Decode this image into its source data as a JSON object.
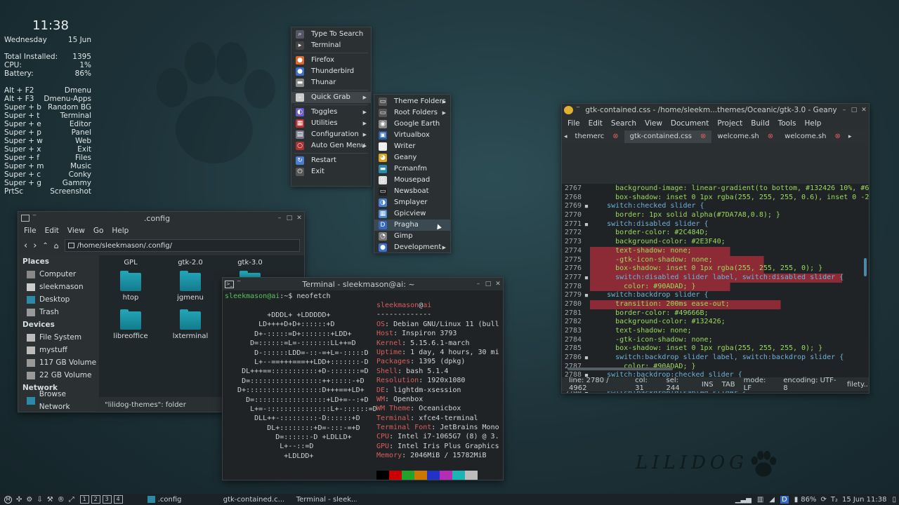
{
  "conky": {
    "time": "11:38",
    "day": "Wednesday",
    "date": "15 Jun",
    "stats": [
      {
        "k": "Total Installed:",
        "v": "1395"
      },
      {
        "k": "CPU:",
        "v": "1%"
      },
      {
        "k": "Battery:",
        "v": "86%"
      }
    ],
    "keys": [
      {
        "k": "Alt + F2",
        "v": "Dmenu"
      },
      {
        "k": "Alt + F3",
        "v": "Dmenu-Apps"
      },
      {
        "k": "Super + b",
        "v": "Random BG"
      },
      {
        "k": "Super + t",
        "v": "Terminal"
      },
      {
        "k": "Super + e",
        "v": "Editor"
      },
      {
        "k": "Super + p",
        "v": "Panel"
      },
      {
        "k": "Super + w",
        "v": "Web"
      },
      {
        "k": "Super + x",
        "v": "Exit"
      },
      {
        "k": "Super + f",
        "v": "Files"
      },
      {
        "k": "Super + m",
        "v": "Music"
      },
      {
        "k": "Super + c",
        "v": "Conky"
      },
      {
        "k": "Super + g",
        "v": "Gammy"
      },
      {
        "k": "PrtSc",
        "v": "Screenshot"
      }
    ]
  },
  "root_menu": {
    "items": [
      "Type To Search",
      "Terminal",
      "Firefox",
      "Thunderbird",
      "Thunar",
      "Quick Grab",
      "Toggles",
      "Utilities",
      "Configuration",
      "Auto Gen Menu",
      "Restart",
      "Exit"
    ]
  },
  "submenu": {
    "items": [
      "Theme Folders",
      "Root Folders",
      "Google Earth",
      "Virtualbox",
      "Writer",
      "Geany",
      "Pcmanfm",
      "Mousepad",
      "Newsboat",
      "Smplayer",
      "Gpicview",
      "Pragha",
      "Gimp",
      "Development"
    ]
  },
  "filemanager": {
    "title": ".config",
    "menu": [
      "File",
      "Edit",
      "View",
      "Go",
      "Help"
    ],
    "path": "/home/sleekmason/.config/",
    "places_header": "Places",
    "places": [
      "Computer",
      "sleekmason",
      "Desktop",
      "Trash"
    ],
    "devices_header": "Devices",
    "devices": [
      "File System",
      "mystuff",
      "117 GB Volume",
      "22 GB Volume"
    ],
    "network_header": "Network",
    "network": [
      "Browse Network"
    ],
    "files": [
      "GPL",
      "gtk-2.0",
      "gtk-3.0",
      "htop",
      "jgmenu",
      "libfm",
      "libreoffice",
      "lxterminal",
      "Mousepad"
    ],
    "ghost": [
      "lilidog-themes",
      "lilidog"
    ],
    "status": "\"lilidog-themes\": folder"
  },
  "terminal": {
    "title": "Terminal - sleekmason@ai: ~",
    "prompt": "sleekmason@ai",
    "cmd": ":~$ neofetch",
    "art": [
      "          +DDDL+ +LDDDDD+",
      "        LD++++D+D+::::::+D",
      "       D+-:::::=D+:::::::+LDD+",
      "      D=::::::=L=-:::::::LL++=D",
      "       D-::::::LDD=-::-=+L=-:::::D",
      "       L+--==+++===++LDD+:::::::-D",
      "    DL+++==:::::::::::+D-:::::::=D",
      "    D=:::::::::::::::::++:::::-+D",
      "   D+::::::::::::::::::D+++==+LD+",
      "     D=:::::::::::::::::+LD+=--:+D",
      "      L+=-:::::::::::::::L+-::::::=D",
      "       DLL++-:::::::::-D::::::+D",
      "          DL+::::::::+D=-:::-=+D",
      "            D=::::::-D +LDLLD+",
      "             L+--::=D",
      "              +LDLDD+"
    ],
    "user": "sleekmason",
    "host": "ai",
    "sep": "-------------",
    "info": [
      {
        "k": "OS",
        "v": "Debian GNU/Linux 11 (bull"
      },
      {
        "k": "Host",
        "v": "Inspiron 3793"
      },
      {
        "k": "Kernel",
        "v": "5.15.6.1-march"
      },
      {
        "k": "Uptime",
        "v": "1 day, 4 hours, 30 mi"
      },
      {
        "k": "Packages",
        "v": "1395 (dpkg)"
      },
      {
        "k": "Shell",
        "v": "bash 5.1.4"
      },
      {
        "k": "Resolution",
        "v": "1920x1080"
      },
      {
        "k": "DE",
        "v": "lightdm-xsession"
      },
      {
        "k": "WM",
        "v": "Openbox"
      },
      {
        "k": "WM Theme",
        "v": "Oceanicbox"
      },
      {
        "k": "Terminal",
        "v": "xfce4-terminal"
      },
      {
        "k": "Terminal Font",
        "v": "JetBrains Mono"
      },
      {
        "k": "CPU",
        "v": "Intel i7-1065G7 (8) @ 3."
      },
      {
        "k": "GPU",
        "v": "Intel Iris Plus Graphics"
      },
      {
        "k": "Memory",
        "v": "2046MiB / 15782MiB"
      }
    ],
    "palette": [
      "#000000",
      "#cc0000",
      "#22a32a",
      "#cc7700",
      "#2332c6",
      "#b52cb5",
      "#1cb5b5",
      "#bdbdbd"
    ]
  },
  "geany": {
    "title": "gtk-contained.css - /home/sleekm...themes/Oceanic/gtk-3.0 - Geany",
    "menu": [
      "File",
      "Edit",
      "Search",
      "View",
      "Document",
      "Project",
      "Build",
      "Tools",
      "Help"
    ],
    "tabs": [
      "themerc",
      "gtk-contained.css",
      "welcome.sh",
      "welcome.sh"
    ],
    "lines": [
      {
        "n": "2767",
        "t": "      background-image: linear-gradient(to bottom, #132426 10%, #6"
      },
      {
        "n": "2768",
        "t": "      box-shadow: inset 0 1px rgba(255, 255, 255, 0.6), inset 0 -2"
      },
      {
        "n": "2769",
        "t": "    switch:checked slider {"
      },
      {
        "n": "2770",
        "t": "      border: 1px solid alpha(#7DA7A8,0.8); }"
      },
      {
        "n": "2771",
        "t": "    switch:disabled slider {"
      },
      {
        "n": "2772",
        "t": "      border-color: #2C484D;"
      },
      {
        "n": "2773",
        "t": "      background-color: #2E3F40;"
      },
      {
        "n": "2774",
        "t": "      text-shadow: none;"
      },
      {
        "n": "2775",
        "t": "      -gtk-icon-shadow: none;"
      },
      {
        "n": "2776",
        "t": "      box-shadow: inset 0 1px rgba(255, 255, 255, 0); }"
      },
      {
        "n": "2777",
        "t": "      switch:disabled slider label, switch:disabled slider {"
      },
      {
        "n": "2778",
        "t": "        color: #90ADAD; }"
      },
      {
        "n": "2779",
        "t": "    switch:backdrop slider {"
      },
      {
        "n": "2780",
        "t": "      transition: 200ms ease-out;"
      },
      {
        "n": "2781",
        "t": "      border-color: #49666B;"
      },
      {
        "n": "2782",
        "t": "      background-color: #132426;"
      },
      {
        "n": "2783",
        "t": "      text-shadow: none;"
      },
      {
        "n": "2784",
        "t": "      -gtk-icon-shadow: none;"
      },
      {
        "n": "2785",
        "t": "      box-shadow: inset 0 1px rgba(255, 255, 255, 0); }"
      },
      {
        "n": "2786",
        "t": "      switch:backdrop slider label, switch:backdrop slider {"
      },
      {
        "n": "2787",
        "t": "        color: #90ADAD; }"
      },
      {
        "n": "2788",
        "t": "    switch:backdrop:checked slider {"
      },
      {
        "n": "2789",
        "t": "      border-color: rgba(15, 66, 120, 0.7); }"
      },
      {
        "n": "2790",
        "t": "    switch:backdrop:disabled slider {"
      },
      {
        "n": "2791",
        "t": "      border-color: #49666B;"
      }
    ],
    "status": [
      "line: 2780 / 4962",
      "col: 31",
      "sel: 244",
      "INS",
      "TAB",
      "mode: LF",
      "encoding: UTF-8",
      "filety..."
    ]
  },
  "panel": {
    "workspaces": [
      "1",
      "2",
      "3",
      "4"
    ],
    "tasks": [
      ".config",
      "gtk-contained.c...",
      "Terminal - sleek..."
    ],
    "battery": "86%",
    "input": "T₂",
    "clock": "15 Jun 11:38"
  },
  "brand": "LILIDOG"
}
